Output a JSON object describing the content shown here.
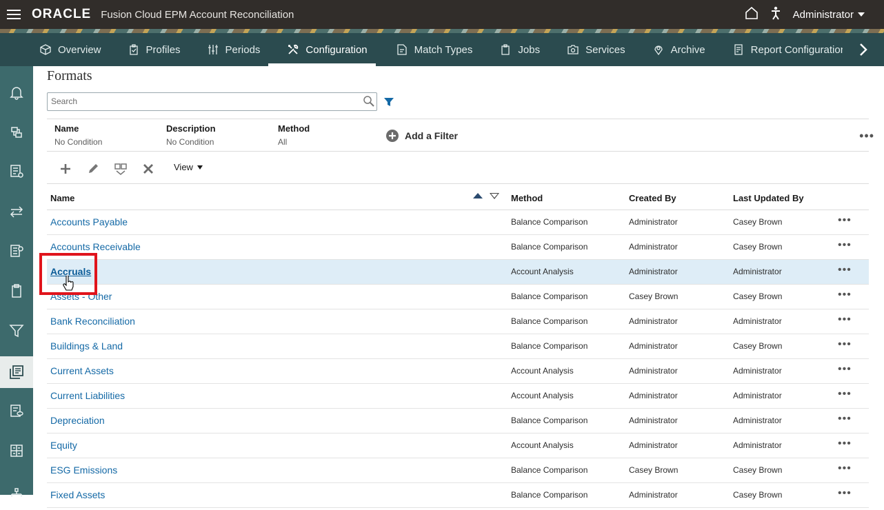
{
  "header": {
    "logo": "ORACLE",
    "app_title": "Fusion Cloud EPM Account Reconciliation",
    "user": "Administrator"
  },
  "nav": {
    "items": [
      {
        "label": "Overview",
        "icon": "cube-icon"
      },
      {
        "label": "Profiles",
        "icon": "clipboard-check-icon"
      },
      {
        "label": "Periods",
        "icon": "sliders-icon"
      },
      {
        "label": "Configuration",
        "icon": "tools-icon",
        "active": true
      },
      {
        "label": "Match Types",
        "icon": "document-icon"
      },
      {
        "label": "Jobs",
        "icon": "clipboard-icon"
      },
      {
        "label": "Services",
        "icon": "camera-icon"
      },
      {
        "label": "Archive",
        "icon": "location-pin-icon"
      },
      {
        "label": "Report Configuratior",
        "icon": "report-icon"
      }
    ]
  },
  "page": {
    "title": "Formats",
    "search_placeholder": "Search"
  },
  "filters": [
    {
      "name": "Name",
      "value": "No Condition"
    },
    {
      "name": "Description",
      "value": "No Condition"
    },
    {
      "name": "Method",
      "value": "All"
    }
  ],
  "add_filter_label": "Add a Filter",
  "toolbar": {
    "view_label": "View"
  },
  "table": {
    "columns": {
      "name": "Name",
      "method": "Method",
      "created_by": "Created By",
      "updated_by": "Last Updated By"
    },
    "rows": [
      {
        "name": "Accounts Payable",
        "method": "Balance Comparison",
        "created_by": "Administrator",
        "updated_by": "Casey Brown"
      },
      {
        "name": "Accounts Receivable",
        "method": "Balance Comparison",
        "created_by": "Administrator",
        "updated_by": "Casey Brown"
      },
      {
        "name": "Accruals",
        "method": "Account Analysis",
        "created_by": "Administrator",
        "updated_by": "Administrator",
        "selected": true
      },
      {
        "name": "Assets - Other",
        "method": "Balance Comparison",
        "created_by": "Casey Brown",
        "updated_by": "Casey Brown"
      },
      {
        "name": "Bank Reconciliation",
        "method": "Balance Comparison",
        "created_by": "Administrator",
        "updated_by": "Administrator"
      },
      {
        "name": "Buildings & Land",
        "method": "Balance Comparison",
        "created_by": "Administrator",
        "updated_by": "Casey Brown"
      },
      {
        "name": "Current Assets",
        "method": "Account Analysis",
        "created_by": "Administrator",
        "updated_by": "Administrator"
      },
      {
        "name": "Current Liabilities",
        "method": "Account Analysis",
        "created_by": "Administrator",
        "updated_by": "Administrator"
      },
      {
        "name": "Depreciation",
        "method": "Balance Comparison",
        "created_by": "Administrator",
        "updated_by": "Administrator"
      },
      {
        "name": "Equity",
        "method": "Account Analysis",
        "created_by": "Administrator",
        "updated_by": "Administrator"
      },
      {
        "name": "ESG Emissions",
        "method": "Balance Comparison",
        "created_by": "Casey Brown",
        "updated_by": "Casey Brown"
      },
      {
        "name": "Fixed Assets",
        "method": "Balance Comparison",
        "created_by": "Administrator",
        "updated_by": "Casey Brown"
      }
    ]
  },
  "colors": {
    "header_bg": "#312d2a",
    "nav_bg": "#2b4b4f",
    "rail_bg": "#3d6a6c",
    "link": "#1469a6",
    "selected_row": "#deedf7",
    "highlight": "#e0141c"
  }
}
